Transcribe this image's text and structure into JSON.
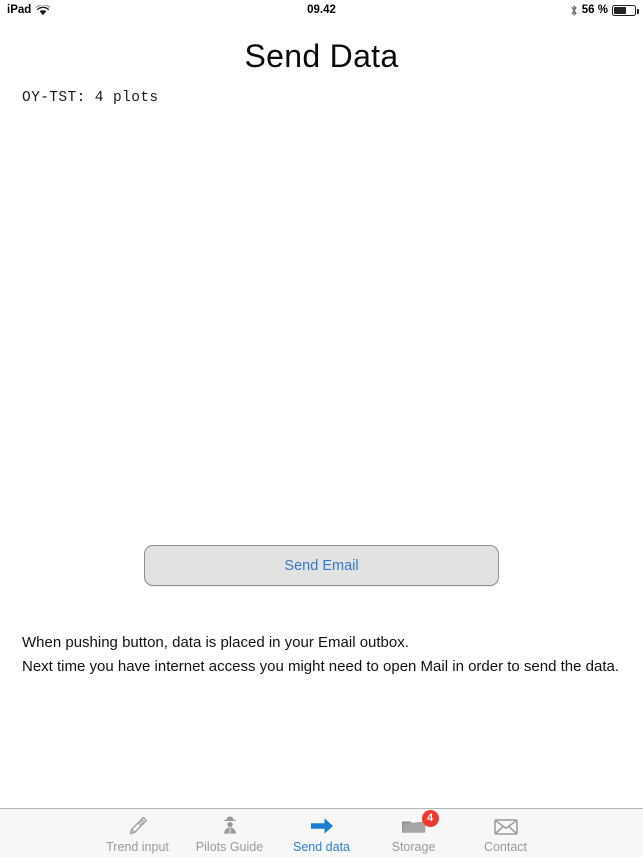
{
  "status_bar": {
    "device": "iPad",
    "wifi_icon": "wifi-icon",
    "time": "09.42",
    "bluetooth_icon": "bluetooth-icon",
    "battery_percent": "56 %",
    "battery_level": 56,
    "battery_icon": "battery-icon"
  },
  "header": {
    "title": "Send Data"
  },
  "main": {
    "plots_summary": "OY-TST: 4 plots",
    "send_button_label": "Send Email",
    "info_lines": [
      "When pushing button, data is placed in your Email outbox.",
      "Next time you have internet access you might need to open Mail in order to send the data."
    ]
  },
  "tab_bar": {
    "items": [
      {
        "label": "Trend input",
        "icon": "pencil-icon",
        "active": false,
        "badge": ""
      },
      {
        "label": "Pilots Guide",
        "icon": "pilot-icon",
        "active": false,
        "badge": ""
      },
      {
        "label": "Send data",
        "icon": "arrow-right-icon",
        "active": true,
        "badge": ""
      },
      {
        "label": "Storage",
        "icon": "folder-icon",
        "active": false,
        "badge": "4"
      },
      {
        "label": "Contact",
        "icon": "envelope-icon",
        "active": false,
        "badge": ""
      }
    ]
  },
  "colors": {
    "accent_blue": "#2f7fd0",
    "button_text_blue": "#3479c9",
    "badge_red": "#ef3b2d",
    "inactive_gray": "#9a9a9a",
    "tabbar_bg": "#f7f7f7",
    "button_bg": "#e2e2e2"
  }
}
